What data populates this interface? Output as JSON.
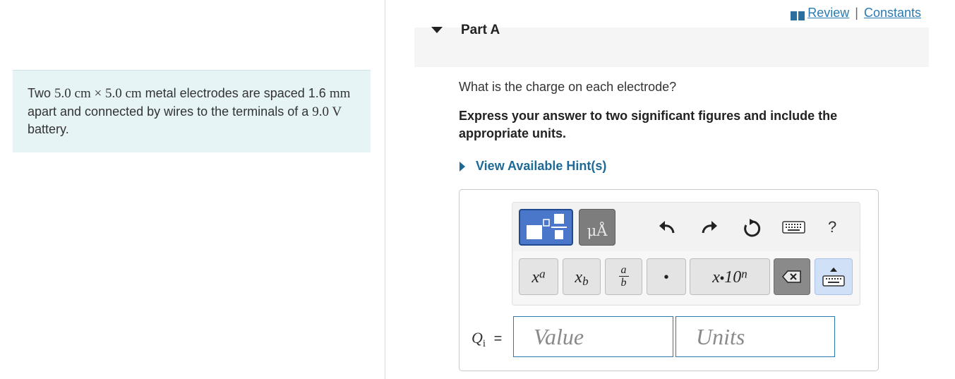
{
  "problem": {
    "text_1": "Two ",
    "dim_1": "5.0 cm × 5.0 cm",
    "text_2": " metal electrodes are spaced ",
    "gap": "1.6 ",
    "gap_unit": "mm",
    "text_3": " apart and connected by wires to the terminals of a ",
    "voltage": "9.0 V",
    "text_4": " battery."
  },
  "links": {
    "review": "Review",
    "separator": "|",
    "constants": "Constants"
  },
  "part": {
    "title": "Part A"
  },
  "question": "What is the charge on each electrode?",
  "instruction": "Express your answer to two significant figures and include the appropriate units.",
  "hint": "View Available Hint(s)",
  "toolbar": {
    "units_label": "μÅ",
    "help_label": "?",
    "superscript": {
      "base": "x",
      "sup": "a"
    },
    "subscript": {
      "base": "x",
      "sub": "b"
    },
    "fraction": {
      "num": "a",
      "den": "b"
    },
    "dot": "•",
    "sci": {
      "base": "x",
      "dot": "•",
      "ten": "10",
      "exp": "n"
    }
  },
  "answer": {
    "label_q": "Q",
    "label_sub": "i",
    "label_eq": "=",
    "value_placeholder": "Value",
    "units_placeholder": "Units"
  },
  "colors": {
    "link": "#2a7ab0",
    "problem_bg": "#e6f4f6",
    "template_button": "#4a77c9",
    "input_border": "#2a7ab0"
  }
}
